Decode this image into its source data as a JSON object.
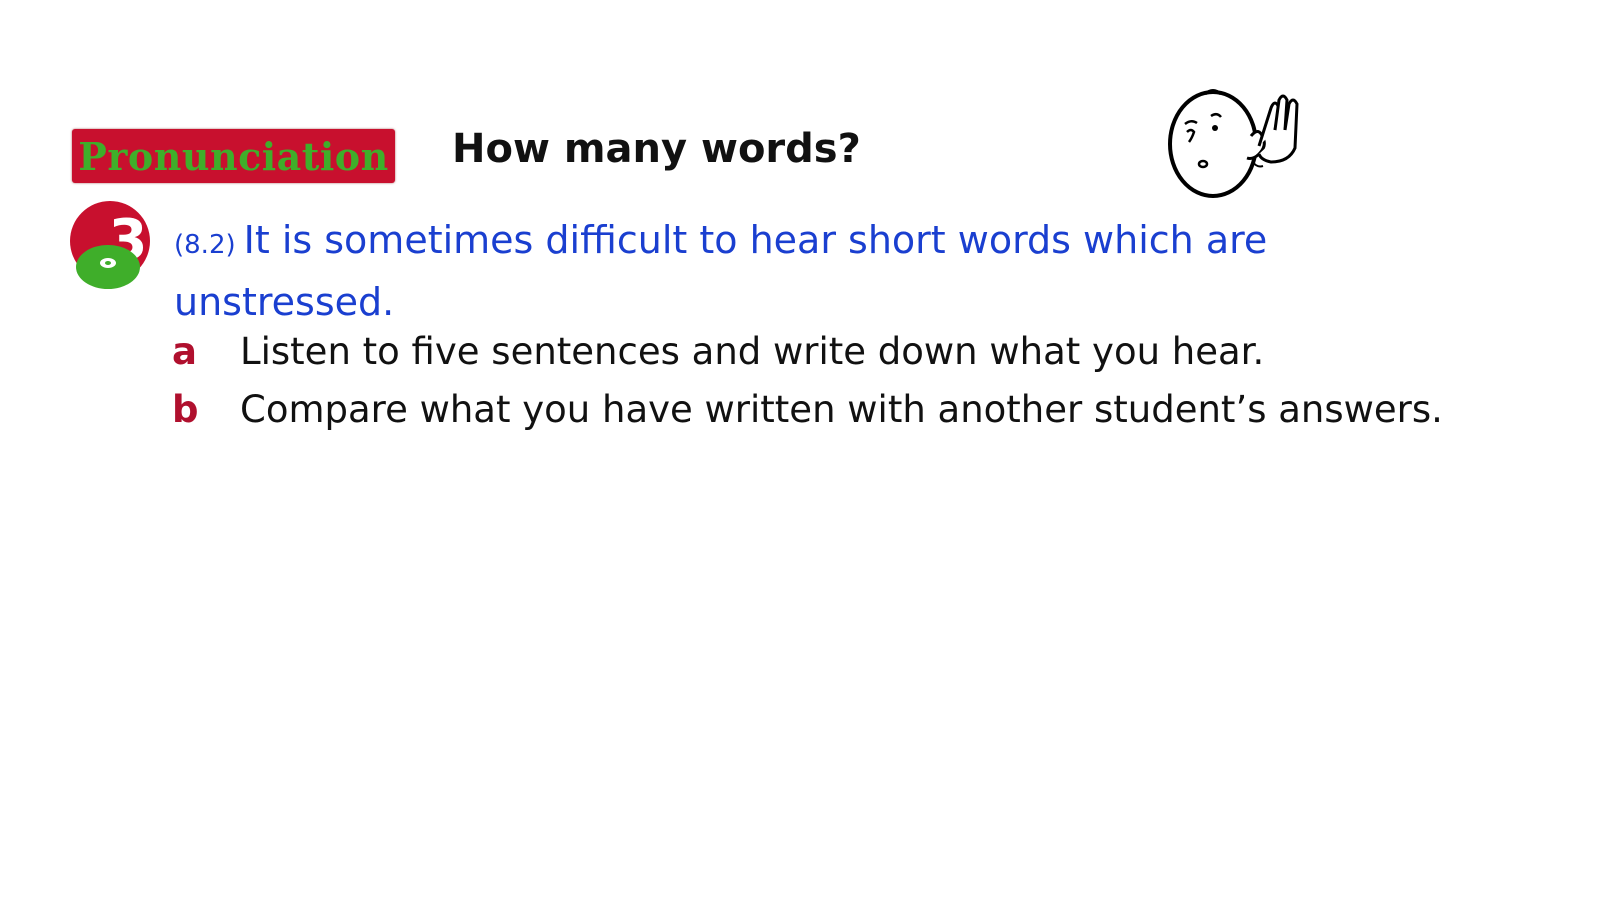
{
  "header": {
    "section_label": "Pronunciation",
    "title": "How many words?"
  },
  "exercise": {
    "number": "3",
    "track": "(8.2)",
    "intro": "It is sometimes difficult to hear short words which are unstressed.",
    "items": [
      {
        "letter": "a",
        "text": "Listen to five sentences and write down what you hear."
      },
      {
        "letter": "b",
        "text": "Compare what you have written with another student’s answers."
      }
    ]
  },
  "icons": {
    "listening": "listening-face-icon",
    "audio": "cd-icon"
  },
  "colors": {
    "badge_bg": "#c8102e",
    "badge_text": "#3fae2a",
    "intro_text": "#1a3fd0",
    "item_letter": "#b0102e",
    "cd": "#3fae2a"
  }
}
